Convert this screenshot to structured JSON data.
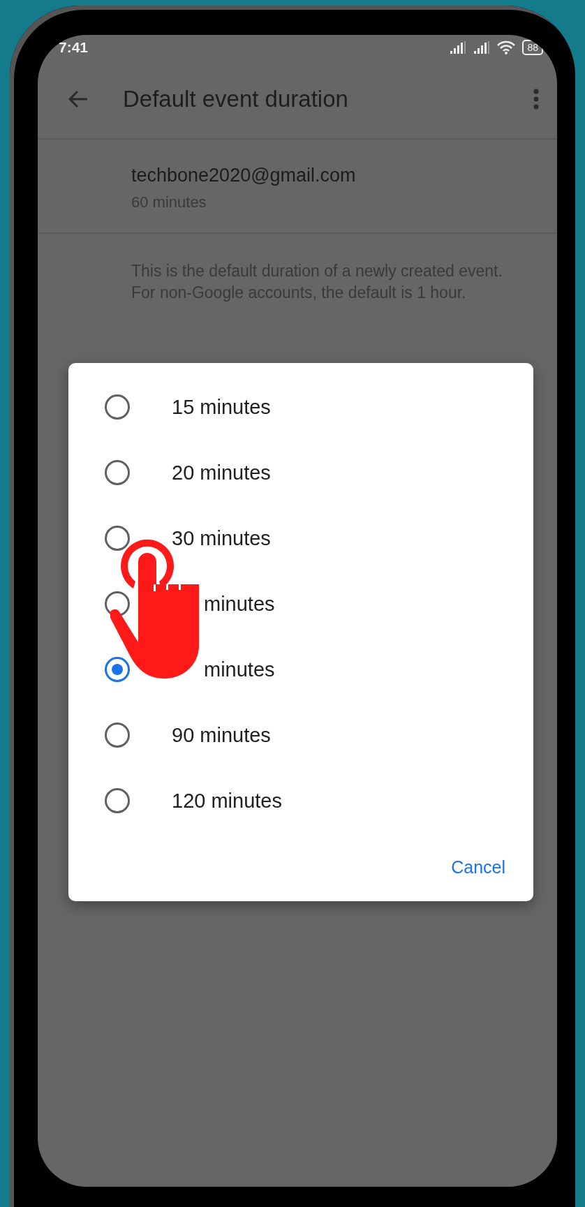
{
  "status_bar": {
    "time": "7:41",
    "battery": "88"
  },
  "toolbar": {
    "title": "Default event duration"
  },
  "account": {
    "email": "techbone2020@gmail.com",
    "duration": "60 minutes"
  },
  "description": [
    "This is the default duration of a newly created event.",
    "For non-Google accounts, the default is 1 hour."
  ],
  "dialog": {
    "options": [
      {
        "label": "15 minutes",
        "selected": false
      },
      {
        "label": "20 minutes",
        "selected": false
      },
      {
        "label": "30 minutes",
        "selected": false
      },
      {
        "label": "minutes",
        "selected": false,
        "kind": "partial"
      },
      {
        "label": "minutes",
        "selected": true,
        "kind": "partial"
      },
      {
        "label": "90 minutes",
        "selected": false
      },
      {
        "label": "120 minutes",
        "selected": false
      }
    ],
    "cancel": "Cancel"
  }
}
